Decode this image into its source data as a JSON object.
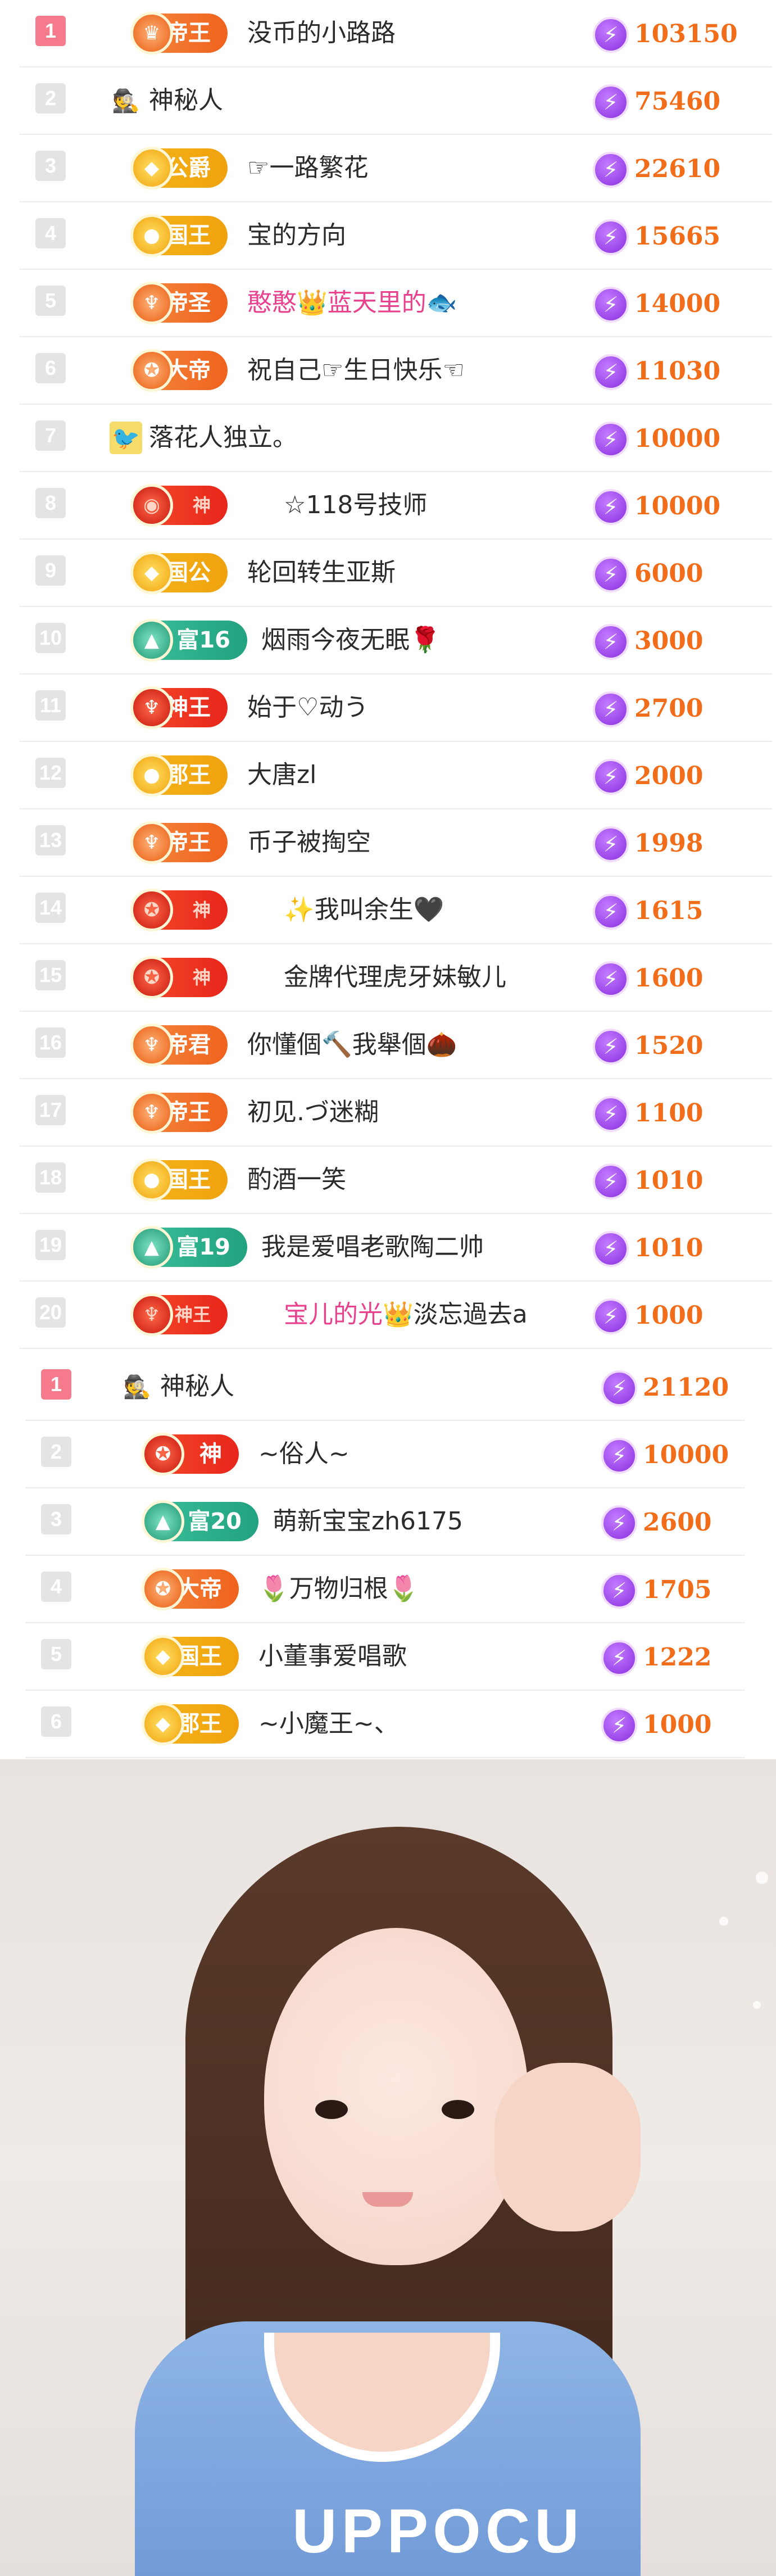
{
  "ranking_primary": [
    {
      "rank": "1",
      "badge": "帝王",
      "badge_style": "orange",
      "emblem": "♛",
      "name": "没币的小路路",
      "score": "103150"
    },
    {
      "rank": "2",
      "badge": "",
      "badge_style": "",
      "emblem": "",
      "avatar": "🕵",
      "name": "神秘人",
      "score": "75460"
    },
    {
      "rank": "3",
      "badge": "公爵",
      "badge_style": "gold",
      "emblem": "◆",
      "name": "☞一路繁花",
      "score": "22610"
    },
    {
      "rank": "4",
      "badge": "国王",
      "badge_style": "gold",
      "emblem": "●",
      "name": "宝的方向",
      "score": "15665"
    },
    {
      "rank": "5",
      "badge": "帝圣",
      "badge_style": "orange",
      "emblem": "♆",
      "name": "憨憨👑蓝天里的🐟",
      "score": "14000",
      "pink": true
    },
    {
      "rank": "6",
      "badge": "大帝",
      "badge_style": "orange",
      "emblem": "✪",
      "name": "祝自己☞生日快乐☜",
      "score": "11030"
    },
    {
      "rank": "7",
      "badge": "",
      "badge_style": "",
      "emblem": "",
      "avatar": "🐦",
      "name": "落花人独立。",
      "score": "10000"
    },
    {
      "rank": "8",
      "badge": "神",
      "badge_style": "red",
      "emblem": "◉",
      "name": "☆118号技师",
      "score": "10000",
      "faint": true
    },
    {
      "rank": "9",
      "badge": "国公",
      "badge_style": "gold",
      "emblem": "◆",
      "name": "轮回转生亚斯",
      "score": "6000"
    },
    {
      "rank": "10",
      "badge": "富16",
      "badge_style": "teal",
      "emblem": "▲",
      "name": "烟雨今夜无眠🌹",
      "score": "3000"
    },
    {
      "rank": "11",
      "badge": "神王",
      "badge_style": "red",
      "emblem": "♆",
      "name": "始于♡动う",
      "score": "2700"
    },
    {
      "rank": "12",
      "badge": "郡王",
      "badge_style": "gold",
      "emblem": "●",
      "name": "大唐zl",
      "score": "2000"
    },
    {
      "rank": "13",
      "badge": "帝王",
      "badge_style": "orange",
      "emblem": "♆",
      "name": "币子被掏空",
      "score": "1998"
    },
    {
      "rank": "14",
      "badge": "神",
      "badge_style": "red",
      "emblem": "✪",
      "name": "✨我叫余生🖤",
      "score": "1615",
      "faint": true
    },
    {
      "rank": "15",
      "badge": "神",
      "badge_style": "red",
      "emblem": "✪",
      "name": "金牌代理虎牙妹敏儿",
      "score": "1600",
      "faint": true
    },
    {
      "rank": "16",
      "badge": "帝君",
      "badge_style": "orange",
      "emblem": "♆",
      "name": "你懂個🔨我舉個🌰",
      "score": "1520"
    },
    {
      "rank": "17",
      "badge": "帝王",
      "badge_style": "orange",
      "emblem": "♆",
      "name": "初见.づ迷糊",
      "score": "1100"
    },
    {
      "rank": "18",
      "badge": "国王",
      "badge_style": "gold",
      "emblem": "●",
      "name": "酌酒一笑",
      "score": "1010"
    },
    {
      "rank": "19",
      "badge": "富19",
      "badge_style": "teal",
      "emblem": "▲",
      "name": "我是爱唱老歌陶二帅",
      "score": "1010"
    },
    {
      "rank": "20",
      "badge": "神王",
      "badge_style": "red",
      "emblem": "♆",
      "name": "宝儿的光👑淡忘過去a",
      "score": "1000",
      "faint": true,
      "pink_part": "宝儿的光👑",
      "rest": "淡忘過去a"
    }
  ],
  "ranking_secondary": [
    {
      "rank": "1",
      "badge": "",
      "badge_style": "",
      "emblem": "",
      "avatar": "🕵",
      "name": "神秘人",
      "score": "21120"
    },
    {
      "rank": "2",
      "badge": "神",
      "badge_style": "red",
      "emblem": "✪",
      "name": "~俗人~",
      "score": "10000"
    },
    {
      "rank": "3",
      "badge": "富20",
      "badge_style": "teal",
      "emblem": "▲",
      "name": "萌新宝宝zh6175",
      "score": "2600"
    },
    {
      "rank": "4",
      "badge": "大帝",
      "badge_style": "orange",
      "emblem": "✪",
      "name": "🌷万物归根🌷",
      "score": "1705"
    },
    {
      "rank": "5",
      "badge": "国王",
      "badge_style": "gold",
      "emblem": "◆",
      "name": "小董事爱唱歌",
      "score": "1222"
    },
    {
      "rank": "6",
      "badge": "郡王",
      "badge_style": "gold",
      "emblem": "◆",
      "name": "~小魔王~、",
      "score": "1000"
    }
  ],
  "icons": {
    "coin": "lightning-coin-icon",
    "coin_glyph": "⚡"
  },
  "colors": {
    "score": "#f26d1a",
    "rank_top": "#f47a8c",
    "coin": "#8a2fe0"
  },
  "photo": {
    "print_text": "UPPOCU"
  }
}
